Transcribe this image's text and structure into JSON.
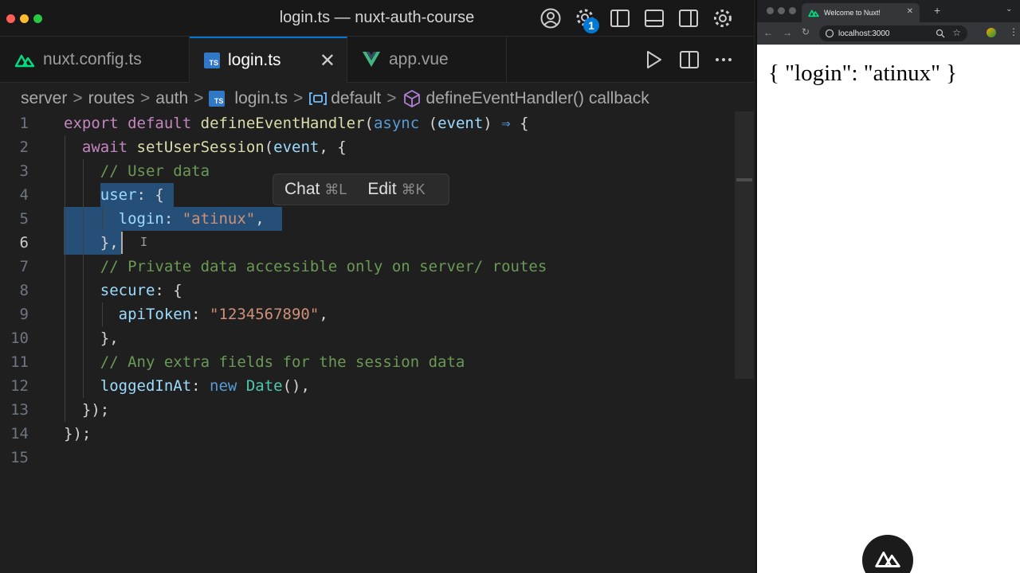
{
  "editor": {
    "window_title": "login.ts — nuxt-auth-course",
    "titlebar_icons": [
      "account-icon",
      "settings-update-icon",
      "toggle-sidebar-icon",
      "toggle-panel-icon",
      "toggle-secondary-sidebar-icon",
      "gear-icon"
    ],
    "update_badge": "1",
    "tabs": [
      {
        "label": "nuxt.config.ts",
        "icon": "nuxt-icon",
        "active": false
      },
      {
        "label": "login.ts",
        "icon": "typescript-icon",
        "active": true
      },
      {
        "label": "app.vue",
        "icon": "vue-icon",
        "active": false
      }
    ],
    "tab_close": "✕",
    "ts_badge": "TS",
    "breadcrumb": {
      "parts": [
        "server",
        "routes",
        "auth",
        "login.ts",
        "default",
        "defineEventHandler() callback"
      ],
      "separator": ">"
    },
    "current_line": 6,
    "code_lines": [
      {
        "n": "1"
      },
      {
        "n": "2"
      },
      {
        "n": "3"
      },
      {
        "n": "4"
      },
      {
        "n": "5"
      },
      {
        "n": "6"
      },
      {
        "n": "7"
      },
      {
        "n": "8"
      },
      {
        "n": "9"
      },
      {
        "n": "10"
      },
      {
        "n": "11"
      },
      {
        "n": "12"
      },
      {
        "n": "13"
      },
      {
        "n": "14"
      },
      {
        "n": "15"
      }
    ],
    "code": {
      "l1_export": "export",
      "l1_default": "default",
      "l1_fn": "defineEventHandler",
      "l1_async": "async",
      "l1_event": "event",
      "l1_arrow": "⇒",
      "l2_await": "await",
      "l2_fn": "setUserSession",
      "l2_event": "event",
      "l3_comment": "// User data",
      "l4_key": "user",
      "l5_key": "login",
      "l5_val": "\"atinux\"",
      "l7_comment": "// Private data accessible only on server/ routes",
      "l8_key": "secure",
      "l9_key": "apiToken",
      "l9_val": "\"1234567890\"",
      "l11_comment": "// Any extra fields for the session data",
      "l12_key": "loggedInAt",
      "l12_new": "new",
      "l12_cls": "Date"
    },
    "inline_hint": {
      "chat_label": "Chat",
      "chat_shortcut": "⌘L",
      "edit_label": "Edit",
      "edit_shortcut": "⌘K"
    },
    "colors": {
      "keyword": "#c586c0",
      "function": "#dcdcaa",
      "variable": "#9cdcfe",
      "string": "#ce9178",
      "comment": "#6a9955",
      "selection": "#264f78",
      "accent": "#0078d4"
    }
  },
  "browser": {
    "tab_title": "Welcome to Nuxt!",
    "url": "localhost:3000",
    "page_text": "{ \"login\": \"atinux\" }"
  }
}
